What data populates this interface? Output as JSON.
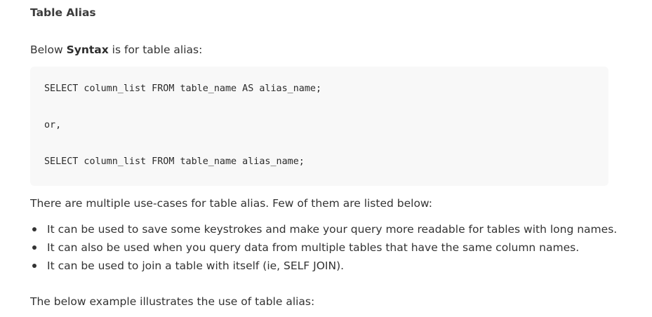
{
  "heading": "Table Alias",
  "intro": {
    "prefix": "Below ",
    "emphasis": "Syntax",
    "suffix": " is for table alias:"
  },
  "code": {
    "lines": [
      "SELECT column_list FROM table_name AS alias_name;",
      "or,",
      "SELECT column_list FROM table_name alias_name;"
    ]
  },
  "usecases_intro": "There are multiple use-cases for table alias. Few of them are listed below:",
  "usecases": [
    "It can be used to save some keystrokes and make your query more readable for tables with long names.",
    "It can also be used when you query data from multiple tables that have the same column names.",
    "It can be used to join a table with itself (ie, SELF JOIN)."
  ],
  "example_intro": "The below example illustrates the use of table alias:"
}
